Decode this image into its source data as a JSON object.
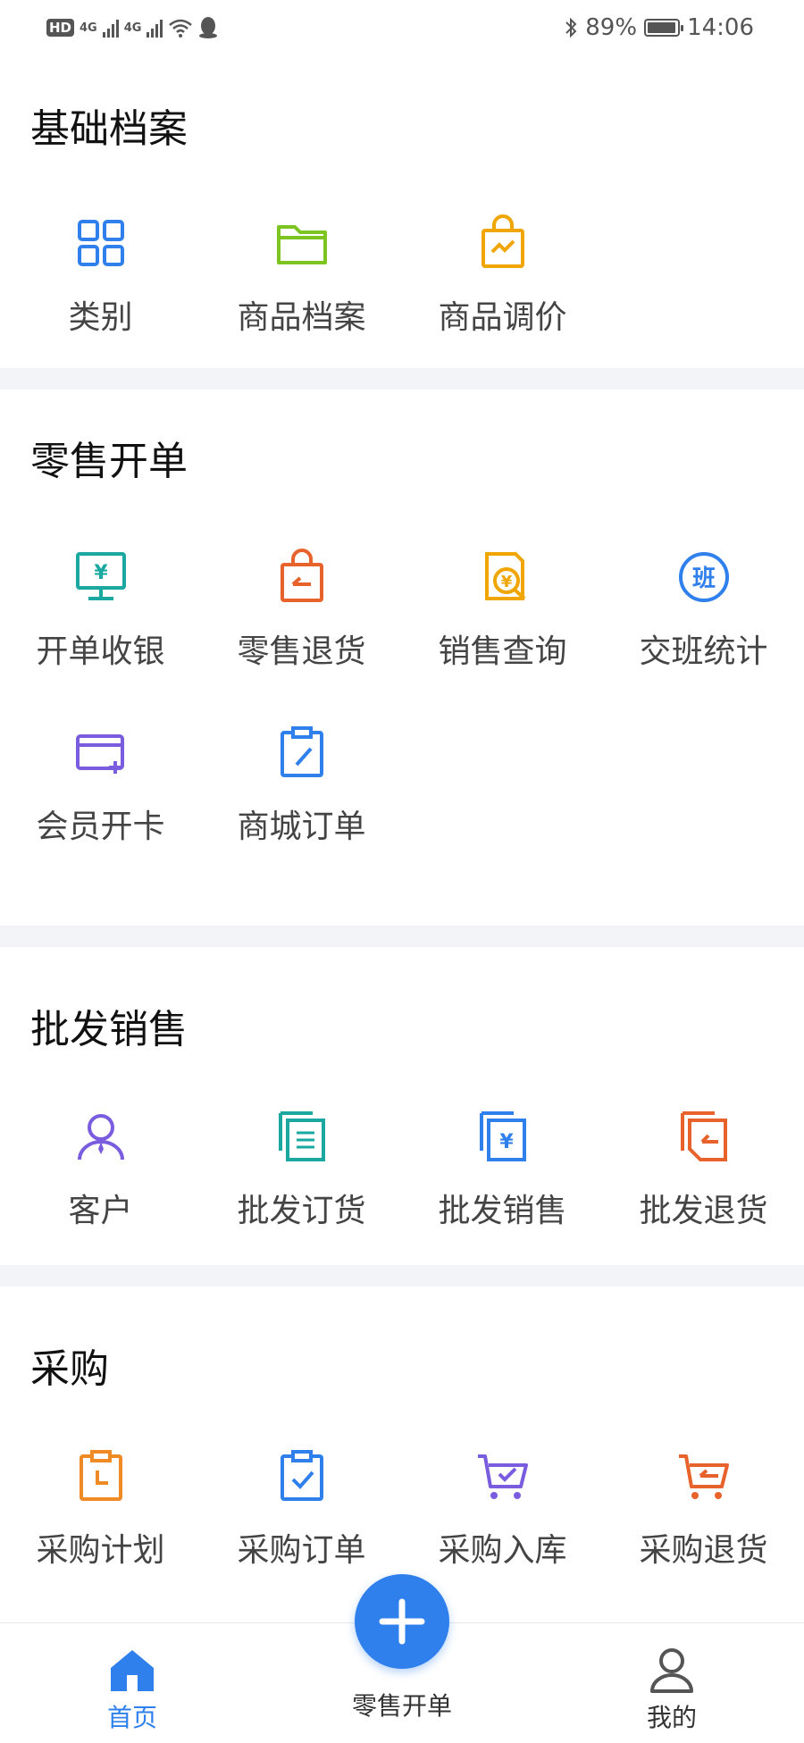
{
  "status": {
    "hd": "HD",
    "net1": "4G",
    "net2": "4G",
    "battery": "89%",
    "time": "14:06"
  },
  "sections": [
    {
      "title": "基础档案",
      "items": [
        {
          "label": "类别",
          "icon": "grid-icon",
          "color": "#2f80ed"
        },
        {
          "label": "商品档案",
          "icon": "folder-icon",
          "color": "#7cc520"
        },
        {
          "label": "商品调价",
          "icon": "price-bag-icon",
          "color": "#f0a500"
        }
      ]
    },
    {
      "title": "零售开单",
      "items": [
        {
          "label": "开单收银",
          "icon": "cash-register-icon",
          "color": "#1aa8a0"
        },
        {
          "label": "零售退货",
          "icon": "return-bag-icon",
          "color": "#e8622c"
        },
        {
          "label": "销售查询",
          "icon": "sales-search-icon",
          "color": "#f0a500"
        },
        {
          "label": "交班统计",
          "icon": "shift-icon",
          "color": "#2f80ed",
          "glyph": "班"
        },
        {
          "label": "会员开卡",
          "icon": "member-card-icon",
          "color": "#7a5cde"
        },
        {
          "label": "商城订单",
          "icon": "clipboard-edit-icon",
          "color": "#2f80ed"
        }
      ]
    },
    {
      "title": "批发销售",
      "items": [
        {
          "label": "客户",
          "icon": "customer-icon",
          "color": "#7a5cde"
        },
        {
          "label": "批发订货",
          "icon": "wholesale-order-icon",
          "color": "#1aa8a0"
        },
        {
          "label": "批发销售",
          "icon": "wholesale-sales-icon",
          "color": "#2f80ed"
        },
        {
          "label": "批发退货",
          "icon": "wholesale-return-icon",
          "color": "#e8622c"
        }
      ]
    },
    {
      "title": "采购",
      "items": [
        {
          "label": "采购计划",
          "icon": "purchase-plan-icon",
          "color": "#f08a24"
        },
        {
          "label": "采购订单",
          "icon": "purchase-order-icon",
          "color": "#2f80ed"
        },
        {
          "label": "采购入库",
          "icon": "cart-check-icon",
          "color": "#7a5cde"
        },
        {
          "label": "采购退货",
          "icon": "cart-return-icon",
          "color": "#e8622c"
        }
      ]
    }
  ],
  "nav": {
    "home_label": "首页",
    "fab_label": "零售开单",
    "mine_label": "我的",
    "active_color": "#2f80ed"
  }
}
